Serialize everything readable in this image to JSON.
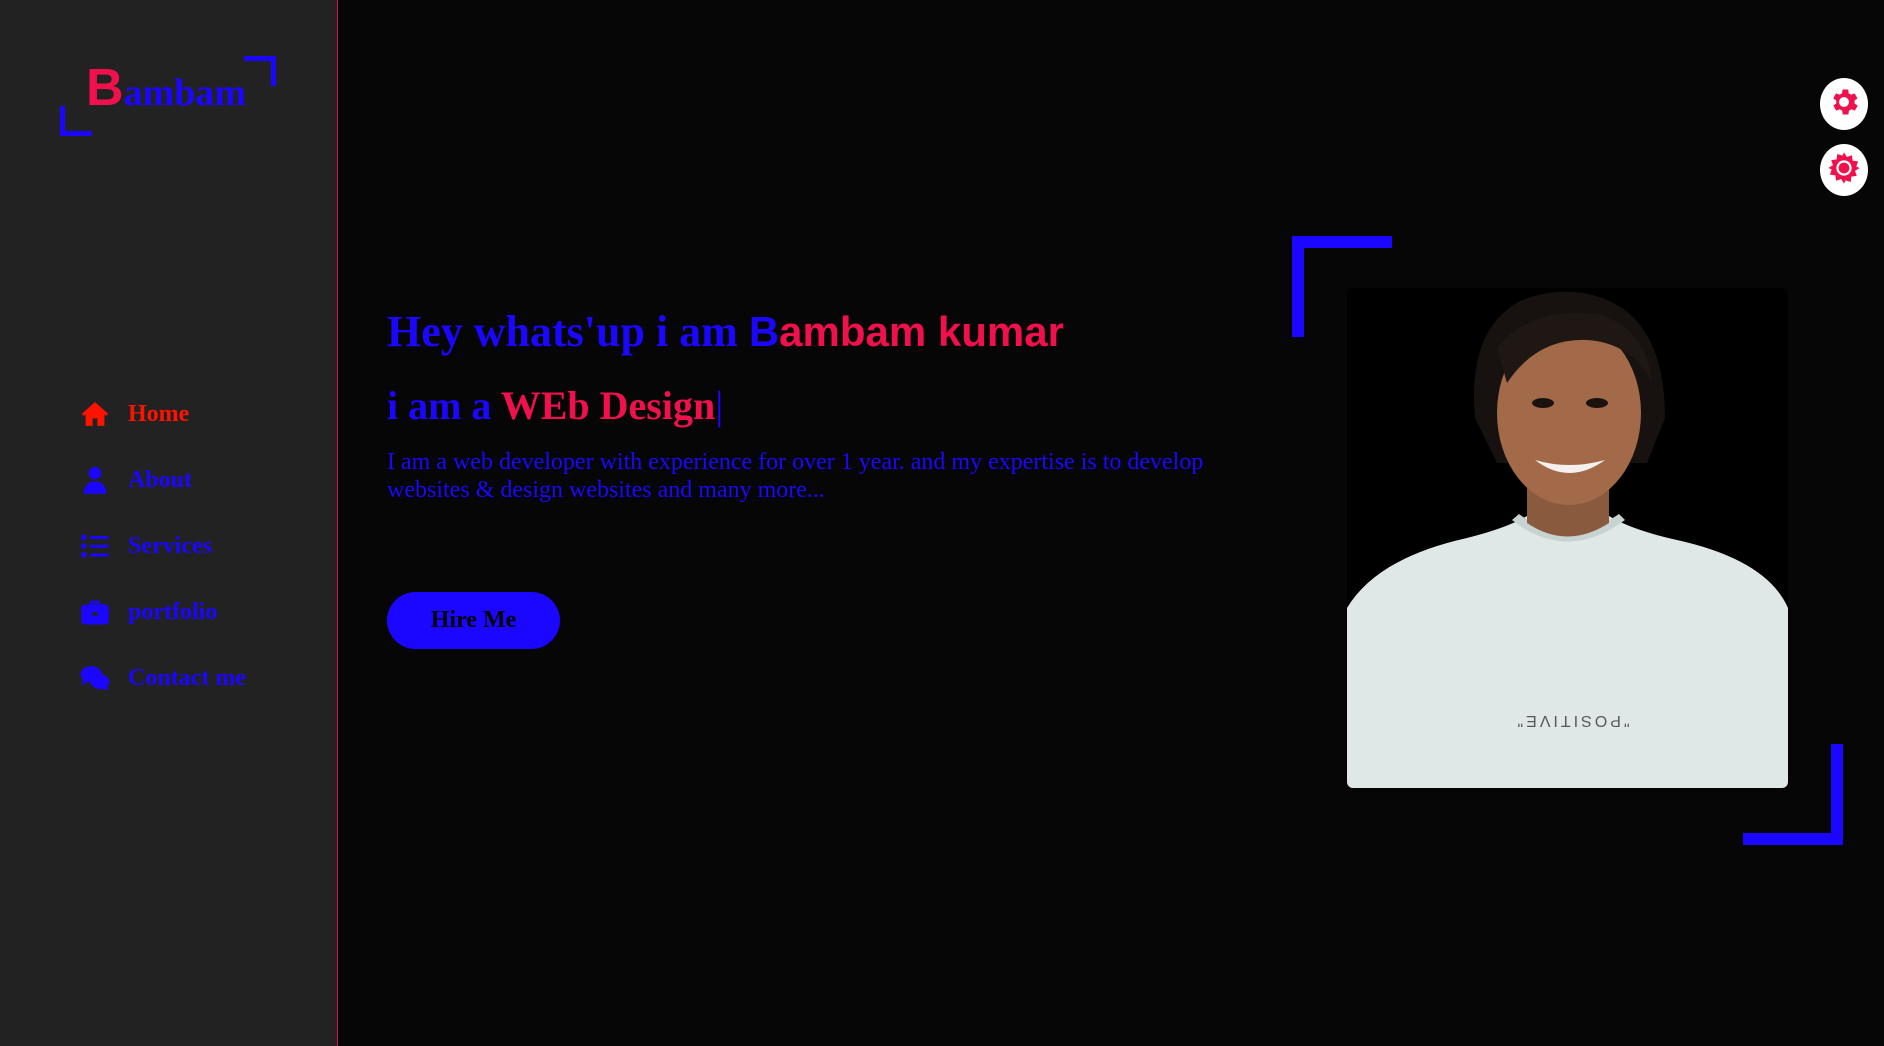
{
  "logo": {
    "first_letter": "B",
    "rest": "ambam"
  },
  "sidebar": {
    "items": [
      {
        "label": "Home",
        "icon": "home-icon",
        "active": true
      },
      {
        "label": "About",
        "icon": "user-icon",
        "active": false
      },
      {
        "label": "Services",
        "icon": "list-icon",
        "active": false
      },
      {
        "label": "portfolio",
        "icon": "briefcase-icon",
        "active": false
      },
      {
        "label": "Contact me",
        "icon": "comments-icon",
        "active": false
      }
    ]
  },
  "hero": {
    "greeting": "Hey whats'up i am ",
    "name_first": "B",
    "name_rest": "ambam kumar",
    "role_prefix": "i am a ",
    "role_typed": "WEb Design",
    "caret": "|",
    "description": "I am a web developer with experience for over 1 year. and my expertise is to develop websites & design websites and many more...",
    "hire_label": "Hire Me"
  },
  "photo": {
    "shirt_text": "\"POSITIVE\""
  },
  "floating": [
    {
      "icon": "gear-icon"
    },
    {
      "icon": "sun-icon"
    }
  ],
  "colors": {
    "accent_blue": "#1b06ff",
    "accent_red": "#f0104b",
    "active_nav": "#ff1200",
    "sidebar_bg": "#222223",
    "page_bg": "#060607"
  }
}
